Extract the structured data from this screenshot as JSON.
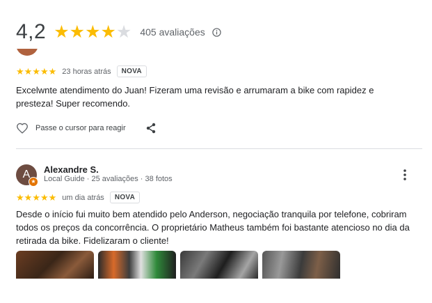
{
  "summary": {
    "rating": "4,2",
    "stars_filled": 4,
    "stars_total": 5,
    "count_label": "405 avaliações",
    "info_icon": "info-icon"
  },
  "reviews": [
    {
      "stars": 5,
      "time": "23 horas atrás",
      "badge": "NOVA",
      "text": "Excelwnte atendimento do Juan! Fizeram uma revisão e arrumaram a bike com rapidez e presteza! Super recomendo.",
      "react_label": "Passe o cursor para reagir",
      "heart_icon": "heart-outline-icon",
      "share_icon": "share-icon"
    },
    {
      "avatar_letter": "A",
      "author": "Alexandre S.",
      "author_sub": "Local Guide · 25 avaliações · 38 fotos",
      "stars": 5,
      "time": "um dia atrás",
      "badge": "NOVA",
      "text": "Desde o início fui muito bem atendido pelo Anderson, negociação tranquila por telefone, cobriram todos os preços da concorrência. O proprietário Matheus também foi bastante atencioso no dia da retirada da bike. Fidelizaram o cliente!",
      "more_icon": "more-vert-icon",
      "photo_count": 4
    }
  ],
  "colors": {
    "star": "#fbbc04",
    "star_empty": "#dadce0",
    "divider": "#dadce0",
    "text": "#202124",
    "muted": "#5f6368"
  }
}
